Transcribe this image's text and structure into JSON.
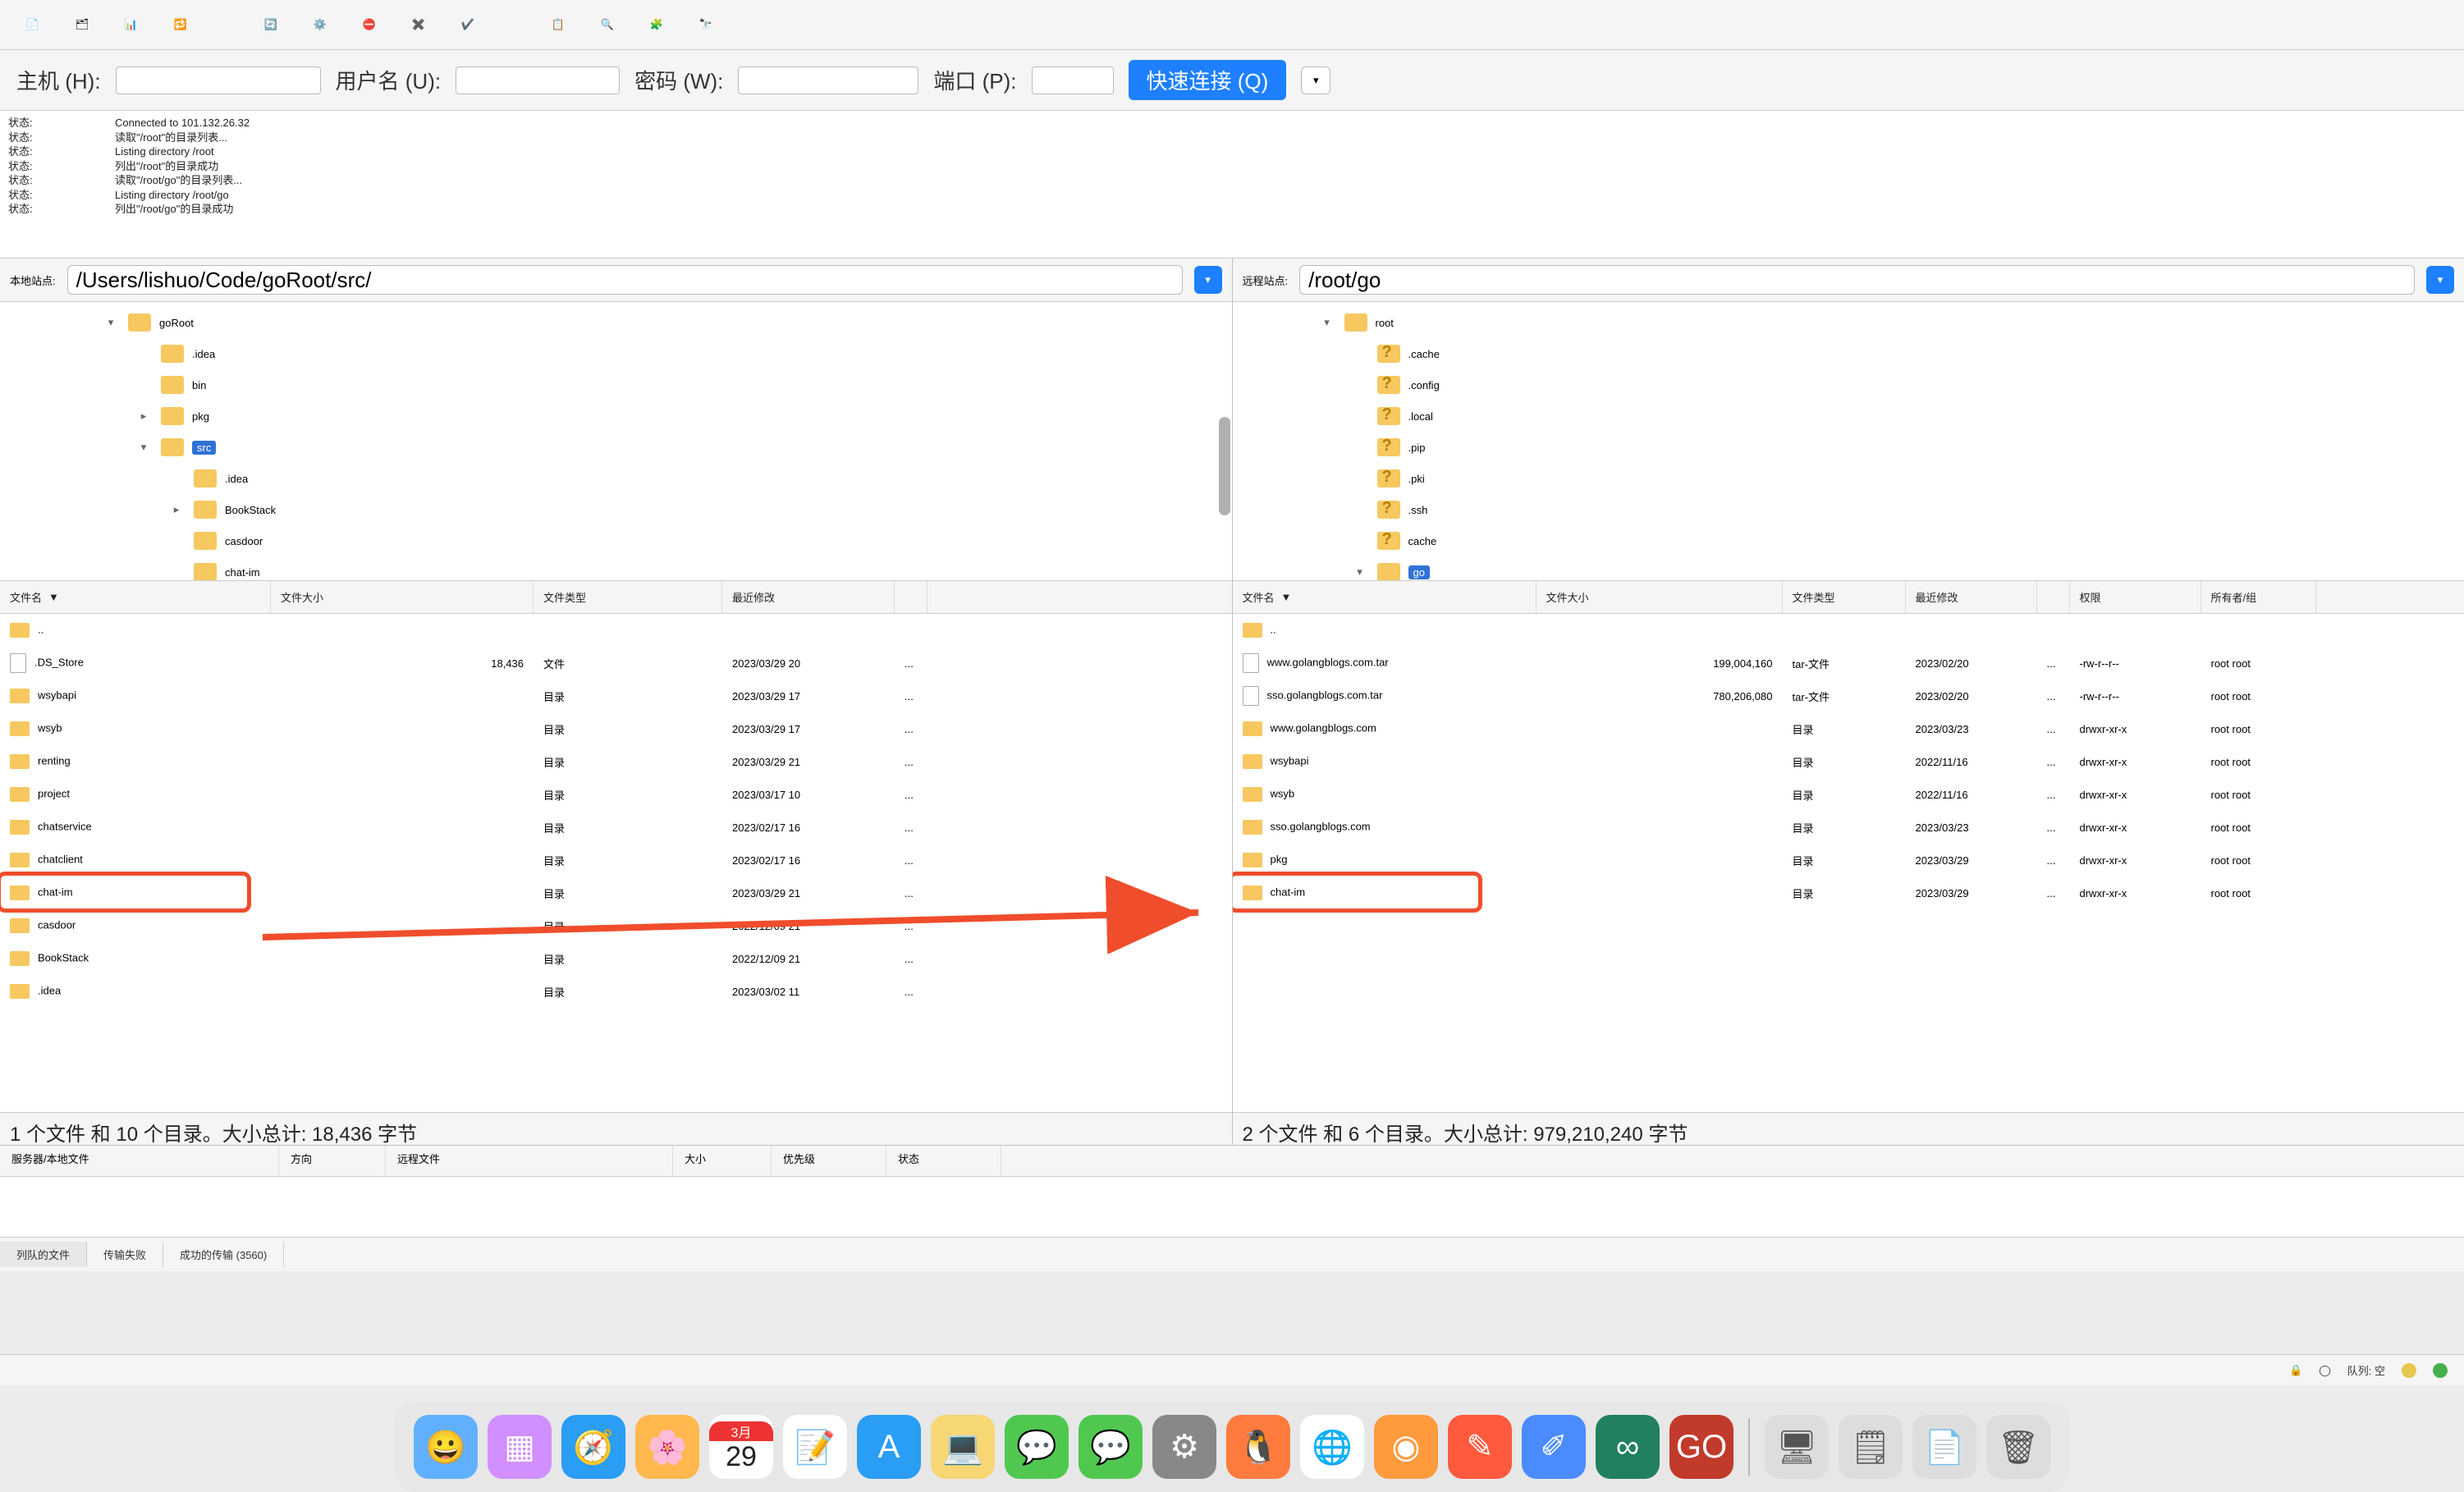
{
  "toolbar_icons": [
    "doc-icon",
    "panels-icon",
    "columns-icon",
    "swap-icon",
    "refresh-icon",
    "settings2-icon",
    "stop-icon",
    "cancel-icon",
    "check-icon",
    "list2-icon",
    "view-icon",
    "filter-icon",
    "search2-icon",
    "binoculars-icon"
  ],
  "connect": {
    "host_label": "主机 (H):",
    "user_label": "用户名 (U):",
    "pass_label": "密码 (W):",
    "port_label": "端口 (P):",
    "quick_label": "快速连接 (Q)"
  },
  "log": [
    {
      "l": "状态:",
      "t": "Connected to 101.132.26.32"
    },
    {
      "l": "状态:",
      "t": "读取\"/root\"的目录列表..."
    },
    {
      "l": "状态:",
      "t": "Listing directory /root"
    },
    {
      "l": "状态:",
      "t": "列出\"/root\"的目录成功"
    },
    {
      "l": "状态:",
      "t": "读取\"/root/go\"的目录列表..."
    },
    {
      "l": "状态:",
      "t": "Listing directory /root/go"
    },
    {
      "l": "状态:",
      "t": "列出\"/root/go\"的目录成功"
    }
  ],
  "local": {
    "site_label": "本地站点:",
    "path": "/Users/lishuo/Code/goRoot/src/",
    "tree": [
      {
        "ind": 120,
        "tw": "▾",
        "name": "goRoot"
      },
      {
        "ind": 160,
        "tw": "",
        "name": ".idea"
      },
      {
        "ind": 160,
        "tw": "",
        "name": "bin"
      },
      {
        "ind": 160,
        "tw": "▸",
        "name": "pkg"
      },
      {
        "ind": 160,
        "tw": "▾",
        "name": "src",
        "sel": true
      },
      {
        "ind": 200,
        "tw": "",
        "name": ".idea"
      },
      {
        "ind": 200,
        "tw": "▸",
        "name": "BookStack"
      },
      {
        "ind": 200,
        "tw": "",
        "name": "casdoor"
      },
      {
        "ind": 200,
        "tw": "",
        "name": "chat-im"
      }
    ],
    "grid_head": {
      "name": "文件名",
      "size": "文件大小",
      "type": "文件类型",
      "mod": "最近修改",
      "sort": "▼"
    },
    "rows": [
      {
        "ico": "fld",
        "name": "..",
        "size": "",
        "type": "",
        "date": ""
      },
      {
        "ico": "file",
        "name": ".DS_Store",
        "size": "18,436",
        "type": "文件",
        "date": "2023/03/29 20",
        "ell": "..."
      },
      {
        "ico": "fld",
        "name": "wsybapi",
        "size": "",
        "type": "目录",
        "date": "2023/03/29 17",
        "ell": "..."
      },
      {
        "ico": "fld",
        "name": "wsyb",
        "size": "",
        "type": "目录",
        "date": "2023/03/29 17",
        "ell": "..."
      },
      {
        "ico": "fld",
        "name": "renting",
        "size": "",
        "type": "目录",
        "date": "2023/03/29 21",
        "ell": "..."
      },
      {
        "ico": "fld",
        "name": "project",
        "size": "",
        "type": "目录",
        "date": "2023/03/17 10",
        "ell": "..."
      },
      {
        "ico": "fld",
        "name": "chatservice",
        "size": "",
        "type": "目录",
        "date": "2023/02/17 16",
        "ell": "..."
      },
      {
        "ico": "fld",
        "name": "chatclient",
        "size": "",
        "type": "目录",
        "date": "2023/02/17 16",
        "ell": "..."
      },
      {
        "ico": "fld",
        "name": "chat-im",
        "size": "",
        "type": "目录",
        "date": "2023/03/29 21",
        "ell": "...",
        "hi": true
      },
      {
        "ico": "fld",
        "name": "casdoor",
        "size": "",
        "type": "目录",
        "date": "2022/12/09 21",
        "ell": "..."
      },
      {
        "ico": "fld",
        "name": "BookStack",
        "size": "",
        "type": "目录",
        "date": "2022/12/09 21",
        "ell": "..."
      },
      {
        "ico": "fld",
        "name": ".idea",
        "size": "",
        "type": "目录",
        "date": "2023/03/02 11",
        "ell": "..."
      }
    ],
    "summary": "1 个文件 和 10 个目录。大小总计: 18,436 字节"
  },
  "remote": {
    "site_label": "远程站点:",
    "path": "/root/go",
    "tree": [
      {
        "ind": 100,
        "tw": "▾",
        "name": "root"
      },
      {
        "ind": 140,
        "tw": "",
        "name": ".cache",
        "q": true
      },
      {
        "ind": 140,
        "tw": "",
        "name": ".config",
        "q": true
      },
      {
        "ind": 140,
        "tw": "",
        "name": ".local",
        "q": true
      },
      {
        "ind": 140,
        "tw": "",
        "name": ".pip",
        "q": true
      },
      {
        "ind": 140,
        "tw": "",
        "name": ".pki",
        "q": true
      },
      {
        "ind": 140,
        "tw": "",
        "name": ".ssh",
        "q": true
      },
      {
        "ind": 140,
        "tw": "",
        "name": "cache",
        "q": true
      },
      {
        "ind": 140,
        "tw": "▾",
        "name": "go",
        "sel": true
      }
    ],
    "grid_head": {
      "name": "文件名",
      "size": "文件大小",
      "type": "文件类型",
      "mod": "最近修改",
      "perm": "权限",
      "own": "所有者/组",
      "sort": "▼"
    },
    "rows": [
      {
        "ico": "fld",
        "name": "..",
        "size": "",
        "type": "",
        "date": "",
        "perm": "",
        "own": ""
      },
      {
        "ico": "file",
        "name": "www.golangblogs.com.tar",
        "size": "199,004,160",
        "type": "tar-文件",
        "date": "2023/02/20",
        "ell": "...",
        "perm": "-rw-r--r--",
        "own": "root root"
      },
      {
        "ico": "file",
        "name": "sso.golangblogs.com.tar",
        "size": "780,206,080",
        "type": "tar-文件",
        "date": "2023/02/20",
        "ell": "...",
        "perm": "-rw-r--r--",
        "own": "root root"
      },
      {
        "ico": "fld",
        "name": "www.golangblogs.com",
        "size": "",
        "type": "目录",
        "date": "2023/03/23",
        "ell": "...",
        "perm": "drwxr-xr-x",
        "own": "root root"
      },
      {
        "ico": "fld",
        "name": "wsybapi",
        "size": "",
        "type": "目录",
        "date": "2022/11/16",
        "ell": "...",
        "perm": "drwxr-xr-x",
        "own": "root root"
      },
      {
        "ico": "fld",
        "name": "wsyb",
        "size": "",
        "type": "目录",
        "date": "2022/11/16",
        "ell": "...",
        "perm": "drwxr-xr-x",
        "own": "root root"
      },
      {
        "ico": "fld",
        "name": "sso.golangblogs.com",
        "size": "",
        "type": "目录",
        "date": "2023/03/23",
        "ell": "...",
        "perm": "drwxr-xr-x",
        "own": "root root"
      },
      {
        "ico": "fld",
        "name": "pkg",
        "size": "",
        "type": "目录",
        "date": "2023/03/29",
        "ell": "...",
        "perm": "drwxr-xr-x",
        "own": "root root"
      },
      {
        "ico": "fld",
        "name": "chat-im",
        "size": "",
        "type": "目录",
        "date": "2023/03/29",
        "ell": "...",
        "perm": "drwxr-xr-x",
        "own": "root root",
        "hi": true
      }
    ],
    "summary": "2 个文件 和 6 个目录。大小总计: 979,210,240 字节"
  },
  "queue_head": {
    "srv": "服务器/本地文件",
    "dir": "方向",
    "rem": "远程文件",
    "size": "大小",
    "pri": "优先级",
    "stat": "状态"
  },
  "tabs": {
    "queued": "列队的文件",
    "failed": "传输失败",
    "ok": "成功的传输 (3560)"
  },
  "statusbar": {
    "queue": "队列: 空"
  },
  "dock_colors": [
    "#61b0ff",
    "#d18fff",
    "#2a9df4",
    "#ffb84d",
    "#ffcc00",
    "#fff",
    "#2a9df4",
    "#f7d774",
    "#50c850",
    "#50c850",
    "#888",
    "#ff7a3d",
    "#fff",
    "#ff9a3d",
    "#ff5a3d",
    "#4a8bff",
    "#208060",
    "#c13a2b"
  ],
  "calendar": {
    "month": "3月",
    "day": "29"
  }
}
